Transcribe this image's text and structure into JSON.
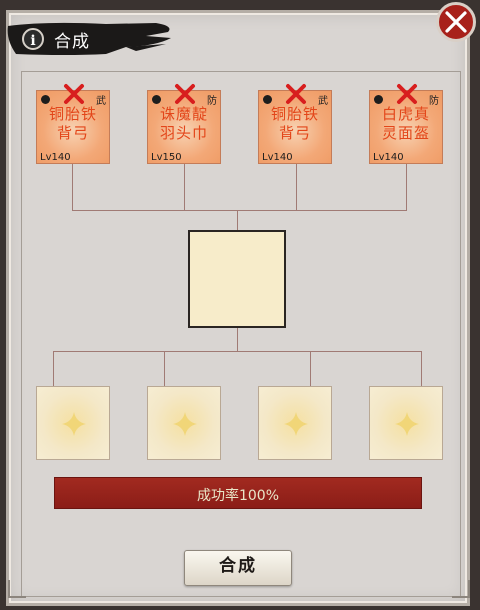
{
  "window": {
    "title": "合成",
    "info_icon_glyph": "i",
    "close_icon": "close-x-icon"
  },
  "equipment_slots": [
    {
      "name_line1": "铜胎铁",
      "name_line2": "背弓",
      "level": "Lv140",
      "type_char": "武",
      "marked_x": true
    },
    {
      "name_line1": "诛魔靛",
      "name_line2": "羽头巾",
      "level": "Lv150",
      "type_char": "防",
      "marked_x": true
    },
    {
      "name_line1": "铜胎铁",
      "name_line2": "背弓",
      "level": "Lv140",
      "type_char": "武",
      "marked_x": true
    },
    {
      "name_line1": "白虎真",
      "name_line2": "灵面盔",
      "level": "Lv140",
      "type_char": "防",
      "marked_x": true
    }
  ],
  "result_slot": {
    "empty": true
  },
  "material_slots": [
    {
      "empty": true,
      "icon": "sparkle-placeholder-icon"
    },
    {
      "empty": true,
      "icon": "sparkle-placeholder-icon"
    },
    {
      "empty": true,
      "icon": "sparkle-placeholder-icon"
    },
    {
      "empty": true,
      "icon": "sparkle-placeholder-icon"
    }
  ],
  "success_rate": {
    "text": "成功率100%",
    "value": 100
  },
  "actions": {
    "compose_label": "合成"
  },
  "colors": {
    "rate_bar": "#a22a20",
    "card_name": "#e3461a",
    "close_button": "#a8211a"
  }
}
